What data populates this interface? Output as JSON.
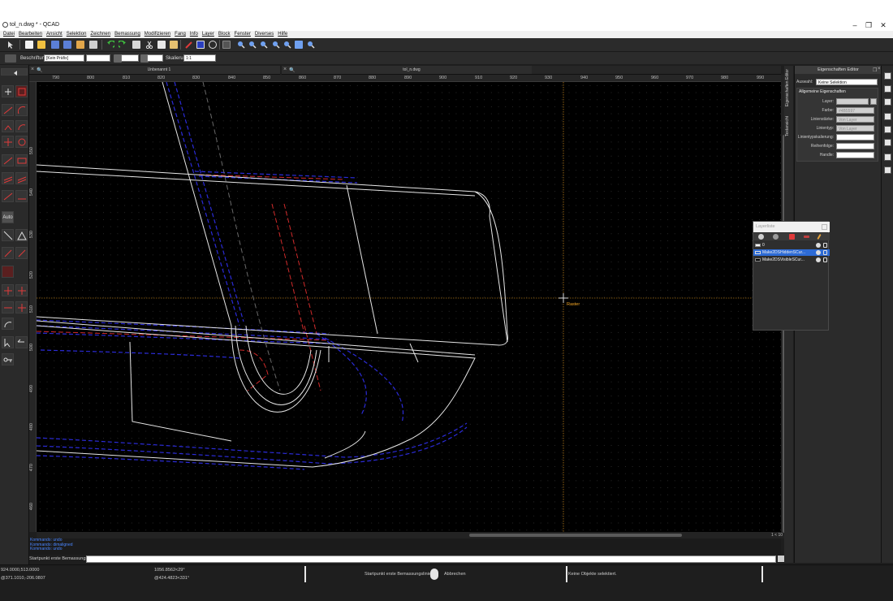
{
  "window": {
    "title": "tol_n.dwg * - QCAD"
  },
  "menu": [
    "Datei",
    "Bearbeiten",
    "Ansicht",
    "Selektion",
    "Zeichnen",
    "Bemassung",
    "Modifizieren",
    "Fang",
    "Info",
    "Layer",
    "Block",
    "Fenster",
    "Diverses",
    "Hilfe"
  ],
  "toolbar2": {
    "label_beschriftung": "Beschriftung:",
    "prefix_value": "[Kein Präfix]",
    "label_skalierung": "Skalierung:",
    "skalierung_value": "1:1"
  },
  "left_tools": {
    "auto_label": "Auto"
  },
  "tabs": [
    {
      "label": "Unbenannt 1"
    },
    {
      "label": "tol_n.dwg"
    }
  ],
  "ruler": {
    "x_ticks": [
      "790",
      "800",
      "810",
      "820",
      "830",
      "840",
      "850",
      "860",
      "870",
      "880",
      "890",
      "900",
      "910",
      "920",
      "930",
      "940",
      "950",
      "960",
      "970",
      "980",
      "990"
    ],
    "y_ticks": [
      "550",
      "540",
      "530",
      "520",
      "510",
      "500",
      "490",
      "480",
      "470",
      "460"
    ]
  },
  "canvas": {
    "snap_label": "Raster",
    "page_count": "1 < 10"
  },
  "command": {
    "history": [
      "Kommando: undo",
      "Kommando: dimaligned",
      "Kommando: undo"
    ],
    "prompt": "Startpunkt erste Bemassungslinie:"
  },
  "vertical_tabs": [
    "Eigenschaften Editor",
    "Textansicht"
  ],
  "property_editor": {
    "title": "Eigenschaften Editor",
    "selection_label": "Auswahl:",
    "selection_value": "Keine Selektion",
    "section": "Allgemeine Eigenschaften",
    "rows": [
      {
        "label": "Layer:",
        "value": ""
      },
      {
        "label": "Farbe:",
        "value": "#4B5597"
      },
      {
        "label": "Linienstärke:",
        "value": "Von Layer"
      },
      {
        "label": "Linientyp:",
        "value": "Von Layer"
      },
      {
        "label": "Linientypskalierung:",
        "value": ""
      },
      {
        "label": "Reihenfolge:",
        "value": ""
      },
      {
        "label": "Handle:",
        "value": ""
      }
    ]
  },
  "layer_list": {
    "title": "Layerliste",
    "layers": [
      {
        "name": "0",
        "selected": false,
        "color": "#ffffff"
      },
      {
        "name": "Make2DSHiddenSCur...",
        "selected": true,
        "color": "#2d6bd6"
      },
      {
        "name": "Make2DSVisibleSCur...",
        "selected": false,
        "color": "#000000"
      }
    ]
  },
  "status": {
    "coord_abs": "924.0000,513.0000",
    "coord_rel": "@371.1010,-206.0807",
    "polar_abs": "1056.8562<29°",
    "polar_rel": "@424.4823<331°",
    "left_button": "Startpunkt erste Bemassungslinie",
    "right_button": "Abbrechen",
    "selection": "Keine Objekte selektiert."
  },
  "colors": {
    "accent": "#2d6bd6",
    "canvas": "#000000",
    "cursor": "#f5a623"
  }
}
